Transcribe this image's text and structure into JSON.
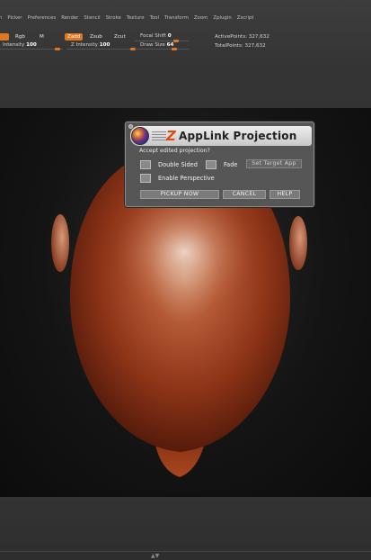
{
  "menu": {
    "items": [
      "n",
      "Picker",
      "Preferences",
      "Render",
      "Stencil",
      "Stroke",
      "Texture",
      "Tool",
      "Transform",
      "Zoom",
      "Zplugin",
      "Zscript"
    ]
  },
  "toolbar": {
    "rgb_label": "Rgb",
    "m_label": "M",
    "zadd_label": "Zadd",
    "zsub_label": "Zsub",
    "zcut_label": "Zcut",
    "intensity_label": "Intensity",
    "intensity_value": "100",
    "z_intensity_label": "Z Intensity",
    "z_intensity_value": "100",
    "focal_shift_label": "Focal Shift",
    "focal_shift_value": "0",
    "draw_size_label": "Draw Size",
    "draw_size_value": "64",
    "active_points_label": "ActivePoints:",
    "active_points_value": "327,632",
    "total_points_label": "TotalPoints:",
    "total_points_value": "327,632",
    "accent_color": "#e0761f"
  },
  "dialog": {
    "z_letter": "Z",
    "title": "AppLink Projection",
    "question": "Accept edited projection?",
    "double_sided_label": "Double Sided",
    "fade_label": "Fade",
    "set_target_label": "Set Target App",
    "enable_perspective_label": "Enable Perspective",
    "pickup_label": "PICKUP NOW",
    "cancel_label": "CANCEL",
    "help_label": "HELP",
    "logo_icon": "zbrush-logo-icon"
  },
  "bottom": {
    "arrow_text": "▲▼"
  }
}
